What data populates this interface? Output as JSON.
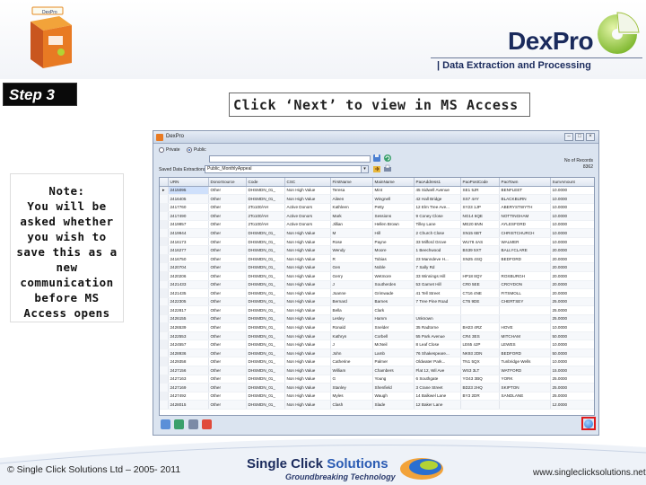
{
  "slide": {
    "step_label": "Step 3",
    "heading": "Click ‘Next’ to view in MS Access",
    "note_lines": [
      "Note:",
      "You will be",
      "asked whether",
      "you wish to",
      "save this as a",
      "new",
      "communication",
      "before MS",
      "Access opens"
    ],
    "brand": "DexPro",
    "brand_dex": "Dex",
    "brand_pro": "Pro",
    "tagline": "| Data Extraction and Processing",
    "footer_copyright": "© Single Click Solutions Ltd – 2005- 2011",
    "footer_logo_a": "Single Click ",
    "footer_logo_b": "Solutions",
    "footer_tagline": "Groundbreaking Technology",
    "footer_url": "www.singleclicksolutions.net"
  },
  "window": {
    "title": "DexPro",
    "radio_private": "Private",
    "radio_public": "Public",
    "saved_label": "Saved Data Extractions :",
    "saved_value": "Public_MonthlyAppeal",
    "records_label": "No of Records",
    "records_value": "8362"
  },
  "grid": {
    "columns": [
      "URN",
      "DonorSource",
      "Code",
      "CSC",
      "FirstName",
      "MainName",
      "PaoAddress1",
      "PaoPostCode",
      "PaoTown",
      "SumAmount"
    ],
    "rows": [
      [
        "2415095",
        "Other",
        "DHSMDN_01_",
        "Non High Value",
        "Teresa",
        "Mint",
        "45 Sidwell Avenue",
        "SE1 5JR",
        "BENFLEET",
        "10.0000"
      ],
      [
        "2416405",
        "Other",
        "DHSMDN_01_",
        "Non High Value",
        "Aileen",
        "Wingnell",
        "42 Hall Bridge",
        "SS7 4AY",
        "BLACKBURN",
        "10.0000"
      ],
      [
        "2417760",
        "Other",
        "2To100/AH",
        "Active Donors",
        "Kathleen",
        "Petty",
        "12 Elm Tree Ave...",
        "SY23 1JP",
        "ABERYSTWYTH",
        "10.0000"
      ],
      [
        "2417490",
        "Other",
        "2To100/AH",
        "Active Donors",
        "Mark",
        "Sessions",
        "9 Coney Close",
        "NG14 6QE",
        "NOTTINGHAM",
        "10.0000"
      ],
      [
        "2419857",
        "Other",
        "2To100/AH",
        "Active Donors",
        "Jillian",
        "Hellen Brown",
        "Tilley Lane",
        "ME20 6NN",
        "AYLESFORD",
        "10.0000"
      ],
      [
        "2419944",
        "Other",
        "DHSMDN_01_",
        "Non High Value",
        "M",
        "Hill",
        "2 Church Close",
        "SN15 6BT",
        "CHRISTCHURCH",
        "10.0000"
      ],
      [
        "2416173",
        "Other",
        "DHSMDN_01_",
        "Non High Value",
        "Rose",
        "Payne",
        "33 Milford Grove",
        "WU78 4AS",
        "WALMER",
        "10.0000"
      ],
      [
        "2416277",
        "Other",
        "DHSMDN_01_",
        "Non High Value",
        "Wendy",
        "Moore",
        "1 Beechwood",
        "BS39 5XT",
        "BALLYCLARE",
        "20.0000"
      ],
      [
        "2416750",
        "Other",
        "DHSMDN_01_",
        "Non High Value",
        "R",
        "Tobias",
        "23 Manndeve H...",
        "SN25 4SQ",
        "BEDFORD",
        "20.0000"
      ],
      [
        "2420704",
        "Other",
        "DHSMDN_01_",
        "Non High Value",
        "Gen",
        "Noble",
        "7 Sally Rd",
        "",
        "",
        "20.0000"
      ],
      [
        "2420206",
        "Other",
        "DHSMDN_01_",
        "Non High Value",
        "Gerry",
        "Wetmore",
        "33 Winnings Hill",
        "HP18 8QY",
        "ROXBURGH",
        "20.0000"
      ],
      [
        "2421433",
        "Other",
        "DHSMDN_01_",
        "Non High Value",
        "J",
        "Southerden",
        "53 Garnet Hill",
        "CR0 5EE",
        "CROYDON",
        "20.0000"
      ],
      [
        "2421435",
        "Other",
        "DHSMDN_01_",
        "Non High Value",
        "Joanne",
        "Grimwade",
        "41 Tell Street",
        "CT16 4NE",
        "FITSMOLL",
        "20.0000"
      ],
      [
        "2422305",
        "Other",
        "DHSMDN_01_",
        "Non High Value",
        "Bernard",
        "Barnes",
        "7 Tree Pine Road",
        "CT6 9DE",
        "CHERTSEY",
        "25.0000"
      ],
      [
        "2422817",
        "Other",
        "DHSMDN_01_",
        "Non High Value",
        "Bella",
        "Clark",
        "",
        "",
        "",
        "25.0000"
      ],
      [
        "2426155",
        "Other",
        "DHSMDN_01_",
        "Non High Value",
        "Lesley",
        "Hamm",
        "Unknown",
        "",
        "",
        "25.0000"
      ],
      [
        "2426539",
        "Other",
        "DHSMDN_01_",
        "Non High Value",
        "Ronald",
        "Snelder",
        "35 Radtorne",
        "BH23 4RZ",
        "HOVE",
        "10.0000"
      ],
      [
        "2422553",
        "Other",
        "DHSMDN_01_",
        "Non High Value",
        "Kathryn",
        "Corbell",
        "55 Park Avenue",
        "CR4 3ES",
        "MITCHAM",
        "50.0000"
      ],
      [
        "2424557",
        "Other",
        "DHSMDN_01_",
        "Non High Value",
        "J",
        "McNeil",
        "8 Leaf Close",
        "LE65 4JP",
        "LEWES",
        "10.0000"
      ],
      [
        "2428936",
        "Other",
        "DHSMDN_01_",
        "Non High Value",
        "John",
        "Lamb",
        "76 Shakespeare...",
        "NK93 2DN",
        "BEDFORD",
        "50.0000"
      ],
      [
        "2429358",
        "Other",
        "DHSMDN_01_",
        "Non High Value",
        "Catherine",
        "Palmer",
        "Oldwater Park...",
        "TN1 5QX",
        "Tunbridge Wells",
        "10.0000"
      ],
      [
        "2427156",
        "Other",
        "DHSMDN_01_",
        "Non High Value",
        "William",
        "Chambers",
        "Flat 12, Wil Ave",
        "WS3 3LT",
        "WATFORD",
        "15.0000"
      ],
      [
        "2427163",
        "Other",
        "DHSMDN_01_",
        "Non High Value",
        "G",
        "Young",
        "6 Southgate",
        "YO43 3BQ",
        "YORK",
        "25.0000"
      ],
      [
        "2427169",
        "Other",
        "DHSMDN_01_",
        "Non High Value",
        "Stanley",
        "Shenfield",
        "3 Crane Street",
        "BD23 2HQ",
        "SKIPTON",
        "25.0000"
      ],
      [
        "2427492",
        "Other",
        "DHSMDN_01_",
        "Non High Value",
        "Myles",
        "Waugh",
        "14 Balkwel Lane",
        "BY3 2DR",
        "SANDLANE",
        "25.0000"
      ],
      [
        "2428015",
        "Other",
        "DHSMDN_01_",
        "Non High Value",
        "Clash",
        "Slade",
        "12 Baker Lane",
        "",
        "",
        "12.0000"
      ]
    ]
  },
  "colors": {
    "accent_red": "#e01b1b",
    "brand_navy": "#1a2a5c",
    "window_bg": "#dbe4f0"
  },
  "icons": [
    "dexpro-box-icon",
    "dexpro-globe-icon",
    "app-icon",
    "save-icon",
    "refresh-icon",
    "export-icon",
    "print-icon",
    "next-icon"
  ]
}
